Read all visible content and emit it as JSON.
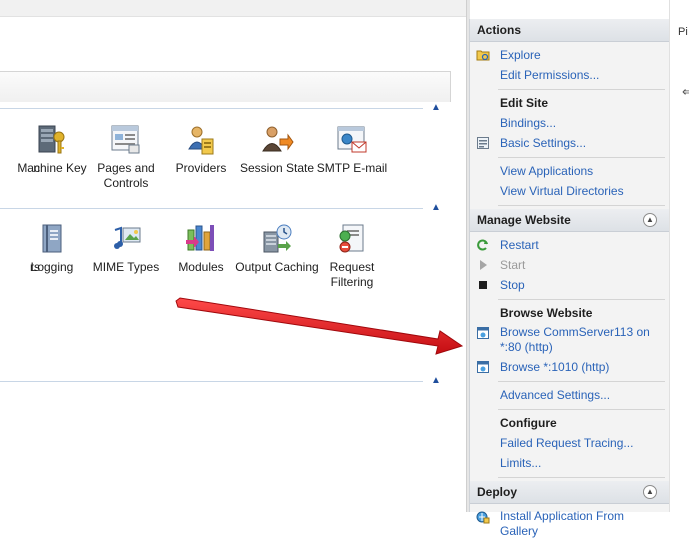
{
  "tiles_row1": [
    {
      "label": "n"
    },
    {
      "label": "Machine Key"
    },
    {
      "label": "Pages and Controls"
    },
    {
      "label": "Providers"
    },
    {
      "label": "Session State"
    },
    {
      "label": "SMTP E-mail"
    }
  ],
  "tiles_row2": [
    {
      "label": "rs"
    },
    {
      "label": "Logging"
    },
    {
      "label": "MIME Types"
    },
    {
      "label": "Modules"
    },
    {
      "label": "Output Caching"
    },
    {
      "label": "Request Filtering"
    }
  ],
  "actions": {
    "title": "Actions",
    "explore": "Explore",
    "edit_permissions": "Edit Permissions...",
    "edit_site_header": "Edit Site",
    "bindings": "Bindings...",
    "basic_settings": "Basic Settings...",
    "view_applications": "View Applications",
    "view_virtual_dirs": "View Virtual Directories",
    "manage_header": "Manage Website",
    "restart": "Restart",
    "start": "Start",
    "stop": "Stop",
    "browse_header": "Browse Website",
    "browse_1": "Browse CommServer113 on *:80 (http)",
    "browse_2": "Browse *:1010 (http)",
    "advanced_settings": "Advanced Settings...",
    "configure_header": "Configure",
    "failed_tracing": "Failed Request Tracing...",
    "limits": "Limits...",
    "deploy_header": "Deploy",
    "install_gallery": "Install Application From Gallery"
  },
  "sliver": {
    "text": "Pi"
  },
  "colors": {
    "link": "#2a63b8",
    "arrow": "#e3151a"
  }
}
